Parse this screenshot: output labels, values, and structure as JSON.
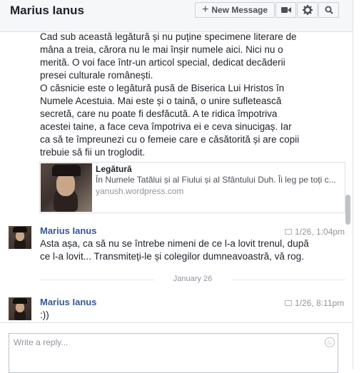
{
  "header": {
    "title": "Marius Ianus",
    "new_message_label": "New Message",
    "icons": [
      "plus-icon",
      "video-icon",
      "gear-icon",
      "search-icon"
    ]
  },
  "thread": {
    "first_message": {
      "paragraphs": [
        "Cad sub această legătură și nu puține specimene literare de mâna a treia, cărora nu le mai înșir numele aici. Nici nu o merită. O voi face într-un articol special, dedicat decăderii presei culturale românești.",
        "O căsnicie este o legătură pusă de Biserica Lui Hristos în Numele Acestuia. Mai este și o taină, o unire sufletească secretă, care nu poate fi desfăcută. A te ridica împotriva acestei taine, a face ceva împotriva ei e ceva sinucigaș. Iar ca să te împreunezi cu o femeie care e căsătorită și are copii trebuie să fii un troglodit."
      ],
      "link_preview": {
        "title": "Legătură",
        "description": "În Numele Tatălui și al Fiului și al Sfântului Duh. Îi leg pe toți c...",
        "domain": "yanush.wordpress.com"
      }
    },
    "messages": [
      {
        "author": "Marius Ianus",
        "time": "1/26, 1:04pm",
        "text": "Asta așa, ca să nu se întrebe nimeni de ce l-a lovit trenul, după ce l-a lovit... Transmiteți-le și colegilor dumneavoastră, vă rog."
      },
      {
        "author": "Marius Ianus",
        "time": "1/26, 8:11pm",
        "text": ":))"
      }
    ],
    "date_divider": "January 26"
  },
  "composer": {
    "placeholder": "Write a reply...",
    "emoji_icon": "emoji-icon"
  }
}
